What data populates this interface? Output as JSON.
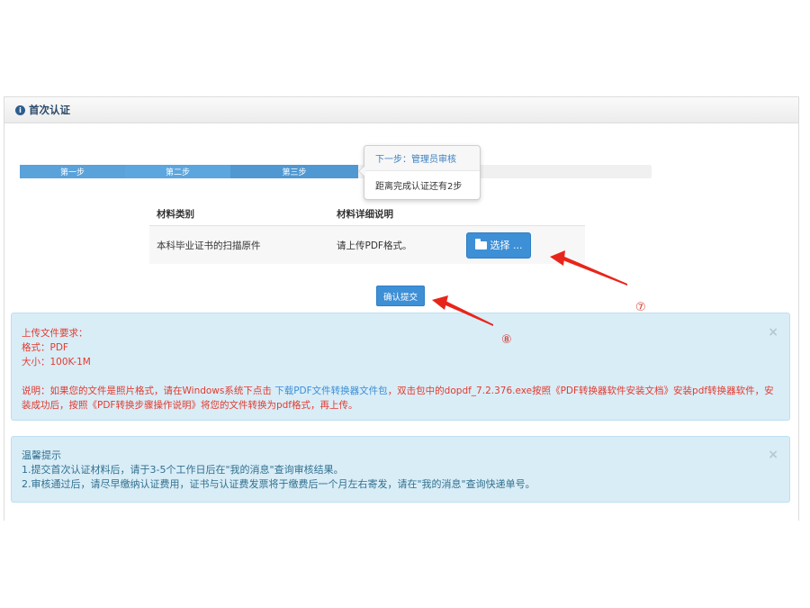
{
  "panel": {
    "title": "首次认证",
    "info_icon": "info-circle-icon"
  },
  "steps": [
    "第一步",
    "第二步",
    "第三步"
  ],
  "popover": {
    "title": "下一步：管理员审核",
    "body": "距离完成认证还有2步"
  },
  "table": {
    "headers": [
      "材料类别",
      "材料详细说明"
    ],
    "rows": [
      {
        "category": "本科毕业证书的扫描原件",
        "description": "请上传PDF格式。",
        "button": "选择 ..."
      }
    ]
  },
  "submit_label": "确认提交",
  "upload_alert": {
    "heading": "上传文件要求：",
    "format": "格式：PDF",
    "size": "大小：100K-1M",
    "note_prefix": "说明：如果您的文件是照片格式，请在Windows系统下点击",
    "note_link": "下载PDF文件转换器文件包",
    "note_suffix": "，双击包中的dopdf_7.2.376.exe按照《PDF转换器软件安装文档》安装pdf转换器软件，安装成功后，按照《PDF转换步骤操作说明》将您的文件转换为pdf格式，再上传。",
    "close": "×"
  },
  "tips_alert": {
    "heading": "温馨提示",
    "line1": "1.提交首次认证材料后，请于3-5个工作日后在\"我的消息\"查询审核结果。",
    "line2": "2.审核通过后，请尽早缴纳认证费用，证书与认证费发票将于缴费后一个月左右寄发，请在\"我的消息\"查询快递单号。",
    "close": "×"
  },
  "annotations": {
    "marker7": "⑦",
    "marker8": "⑧",
    "arrow_color": "#e8251a"
  }
}
